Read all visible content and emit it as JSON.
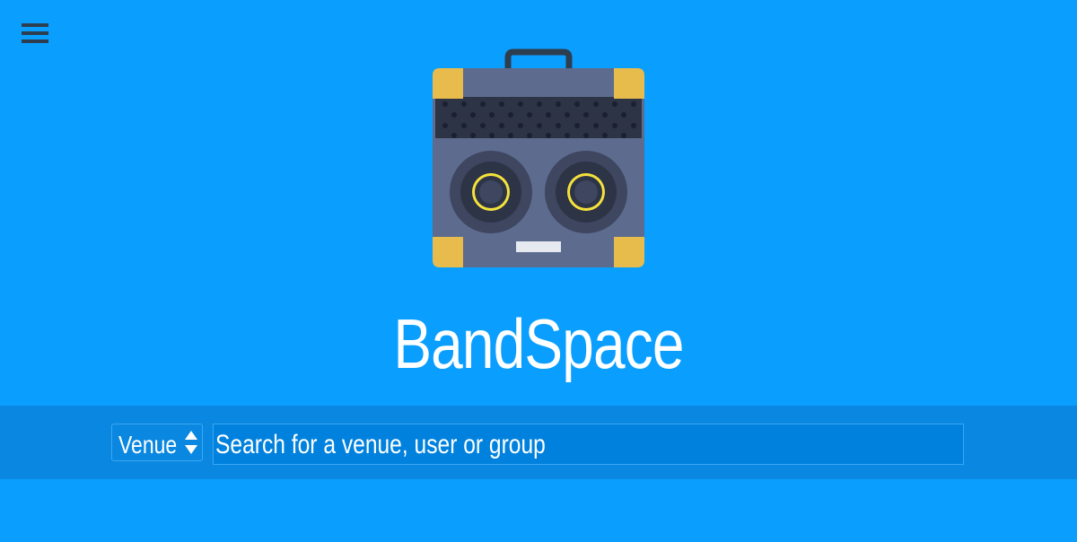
{
  "app": {
    "title": "BandSpace"
  },
  "nav": {
    "menu_icon": "hamburger-menu-icon"
  },
  "logo": {
    "icon": "amplifier-boombox-icon",
    "colors": {
      "body": "#5d6b8e",
      "grille": "#2d3446",
      "corners": "#e8bc4c",
      "speaker_ring": "#f5e23c",
      "handle": "#2d3e50"
    }
  },
  "search": {
    "type_select": {
      "selected": "Venue",
      "icon": "up-down-arrows-icon"
    },
    "placeholder": "Search for a venue, user or group"
  },
  "colors": {
    "background": "#0a9fff",
    "search_band": "#0a87e0",
    "text": "#ffffff"
  }
}
